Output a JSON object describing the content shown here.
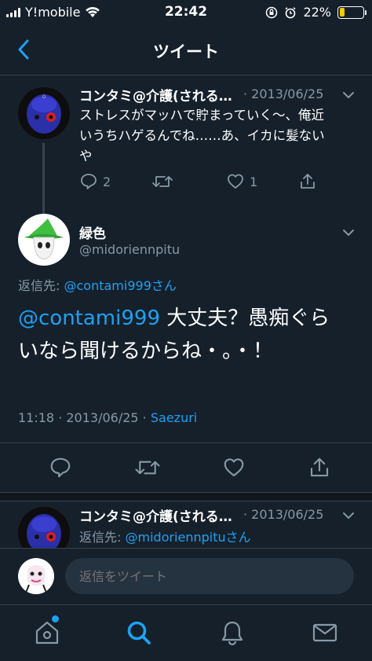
{
  "status_bar": {
    "carrier": "Y!mobile",
    "time": "22:42",
    "battery_percent": "22%",
    "battery_level": 0.22,
    "wifi_icon": "wifi-icon",
    "lock_icon": "orientation-lock-icon",
    "alarm_icon": "alarm-icon"
  },
  "header": {
    "title": "ツイート",
    "back_icon": "chevron-left-icon"
  },
  "thread_parent": {
    "display_name": "コンタミ@介護(される…",
    "date": "· 2013/06/25",
    "text_line1": "ストレスがマッハで貯まっていく〜、俺近",
    "text_line2": "いうちハゲるんでね……あ、イカに髪ない",
    "text_line3": "や",
    "reply_count": "2",
    "like_count": "1"
  },
  "main_tweet": {
    "display_name": "緑色",
    "handle": "@midoriennpitu",
    "reply_to_label": "返信先:",
    "reply_to_user": "@contami999さん",
    "text_mention": "@contami999",
    "text_line1_rest": " 大丈夫？愚痴ぐら",
    "text_line2": "いなら聞けるからね・。・！",
    "time": "11:18",
    "date": "· 2013/06/25 ·",
    "client": "Saezuri"
  },
  "reply_tweet": {
    "display_name": "コンタミ@介護(される…",
    "date": "· 2013/06/25",
    "reply_to_label": "返信先:",
    "reply_to_user": "@midoriennpituさん"
  },
  "reply_bar": {
    "placeholder": "返信をツイート"
  },
  "tab_bar": {
    "items": [
      "home-icon",
      "search-icon",
      "notifications-icon",
      "messages-icon"
    ],
    "active": "search-icon"
  },
  "colors": {
    "background": "#15202b",
    "accent": "#1da1f2",
    "secondary_text": "#8899a6",
    "battery": "#ffcc00"
  }
}
